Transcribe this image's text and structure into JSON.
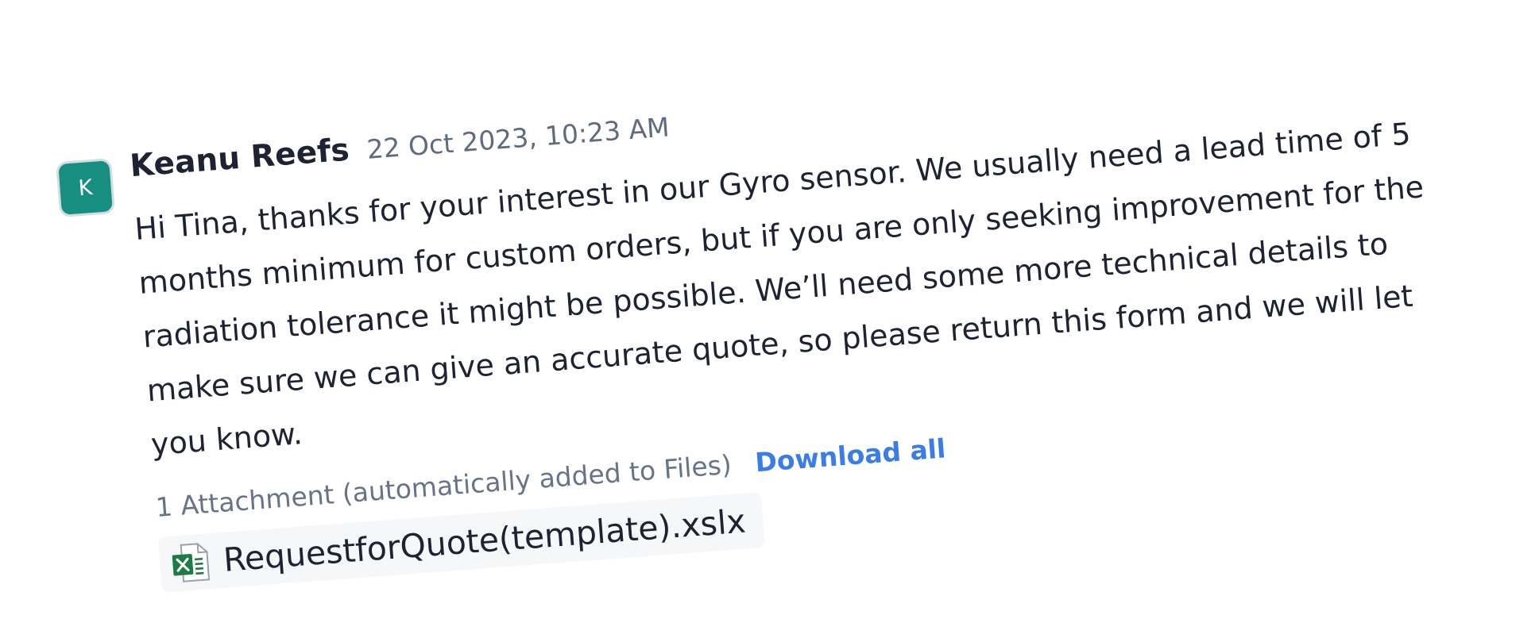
{
  "message": {
    "avatar_initial": "K",
    "author": "Keanu Reefs",
    "timestamp": "22 Oct 2023, 10:23 AM",
    "body": "Hi Tina, thanks for your interest in our Gyro sensor. We usually need a lead time of 5 months minimum for custom orders, but if you are only seeking improvement for the radiation tolerance it might be possible. We’ll need some more technical details to make sure we can give an accurate quote, so please return this form and we will let you know.",
    "attachments": {
      "count_label": "1 Attachment (automatically added to Files)",
      "download_all_label": "Download all",
      "files": [
        {
          "name": "RequestforQuote(template).xslx",
          "icon": "excel-file-icon"
        }
      ]
    }
  },
  "colors": {
    "avatar_bg": "#168f80",
    "link": "#3a7ce8",
    "excel_green": "#1f7a45"
  }
}
